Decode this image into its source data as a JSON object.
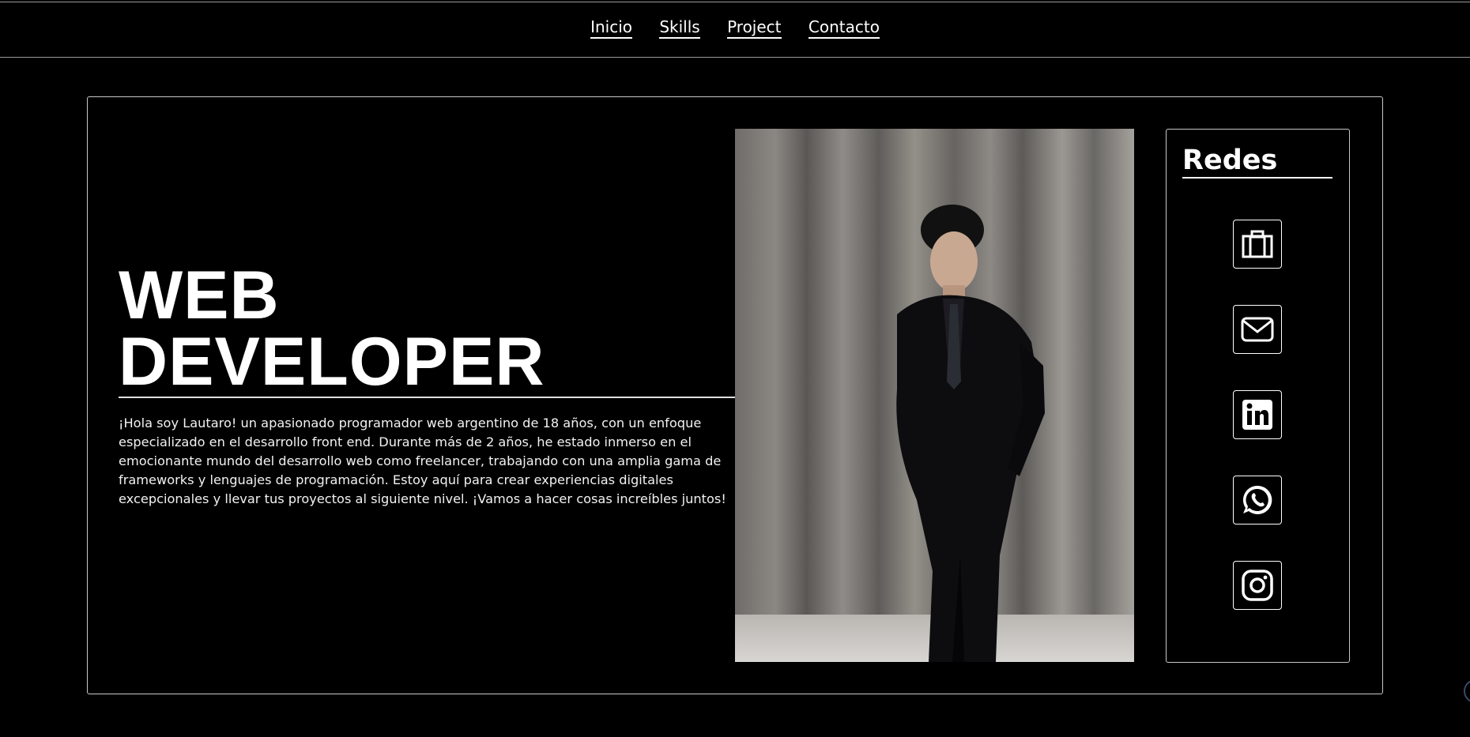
{
  "nav": {
    "items": [
      "Inicio",
      "Skills",
      "Project",
      "Contacto"
    ]
  },
  "hero": {
    "title_line1": "WEB",
    "title_line2": "DEVELOPER",
    "bio": "¡Hola soy Lautaro! un apasionado programador web argentino de 18 años, con un enfoque especializado en el desarrollo front end. Durante más de 2 años, he estado inmerso en el emocionante mundo del desarrollo web como freelancer, trabajando con una amplia gama de frameworks y lenguajes de programación. Estoy aquí para crear experiencias digitales excepcionales y llevar tus proyectos al siguiente nivel. ¡Vamos a hacer cosas increíbles juntos!"
  },
  "redes": {
    "title": "Redes",
    "links": [
      "briefcase-icon",
      "mail-icon",
      "linkedin-icon",
      "whatsapp-icon",
      "instagram-icon"
    ]
  },
  "colors": {
    "background": "#000000",
    "text": "#ffffff",
    "border": "#c8c8c8"
  }
}
